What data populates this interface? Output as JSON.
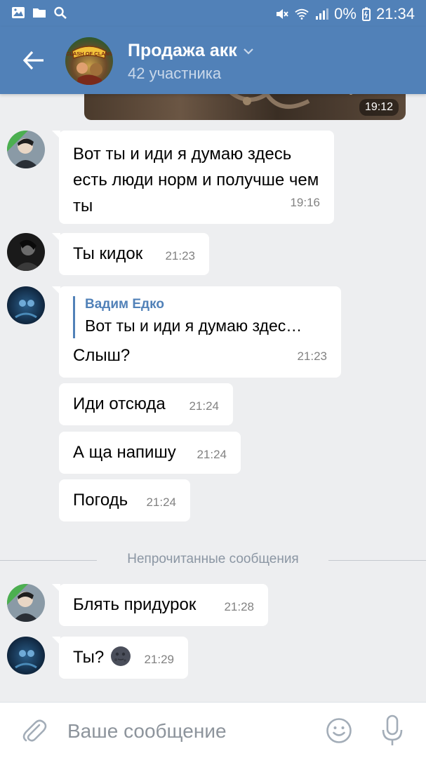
{
  "status_bar": {
    "battery": "0%",
    "time": "21:34"
  },
  "header": {
    "title": "Продажа акк",
    "subtitle": "42 участника",
    "avatar_text": "CLASH OF CLANS"
  },
  "photo_preview": {
    "time": "19:12"
  },
  "messages": [
    {
      "text": "Вот ты и иди я думаю здесь есть люди норм и получше чем ты",
      "time": "19:16"
    },
    {
      "text": "Ты кидок",
      "time": "21:23"
    },
    {
      "reply_name": "Вадим Едко",
      "reply_text": "Вот ты и иди я думаю здес…",
      "text": "Слыш?",
      "time": "21:23"
    },
    {
      "text": "Иди отсюда",
      "time": "21:24"
    },
    {
      "text": "А ща напишу",
      "time": "21:24"
    },
    {
      "text": "Погодь",
      "time": "21:24"
    },
    {
      "text": "Блять придурок",
      "time": "21:28"
    },
    {
      "text": "Ты?",
      "emoji": "new-moon-face",
      "time": "21:29"
    }
  ],
  "divider": {
    "label": "Непрочитанные сообщения"
  },
  "composer": {
    "placeholder": "Ваше сообщение"
  },
  "colors": {
    "accent": "#5181b8",
    "background": "#edeef0",
    "bubble": "#ffffff"
  }
}
